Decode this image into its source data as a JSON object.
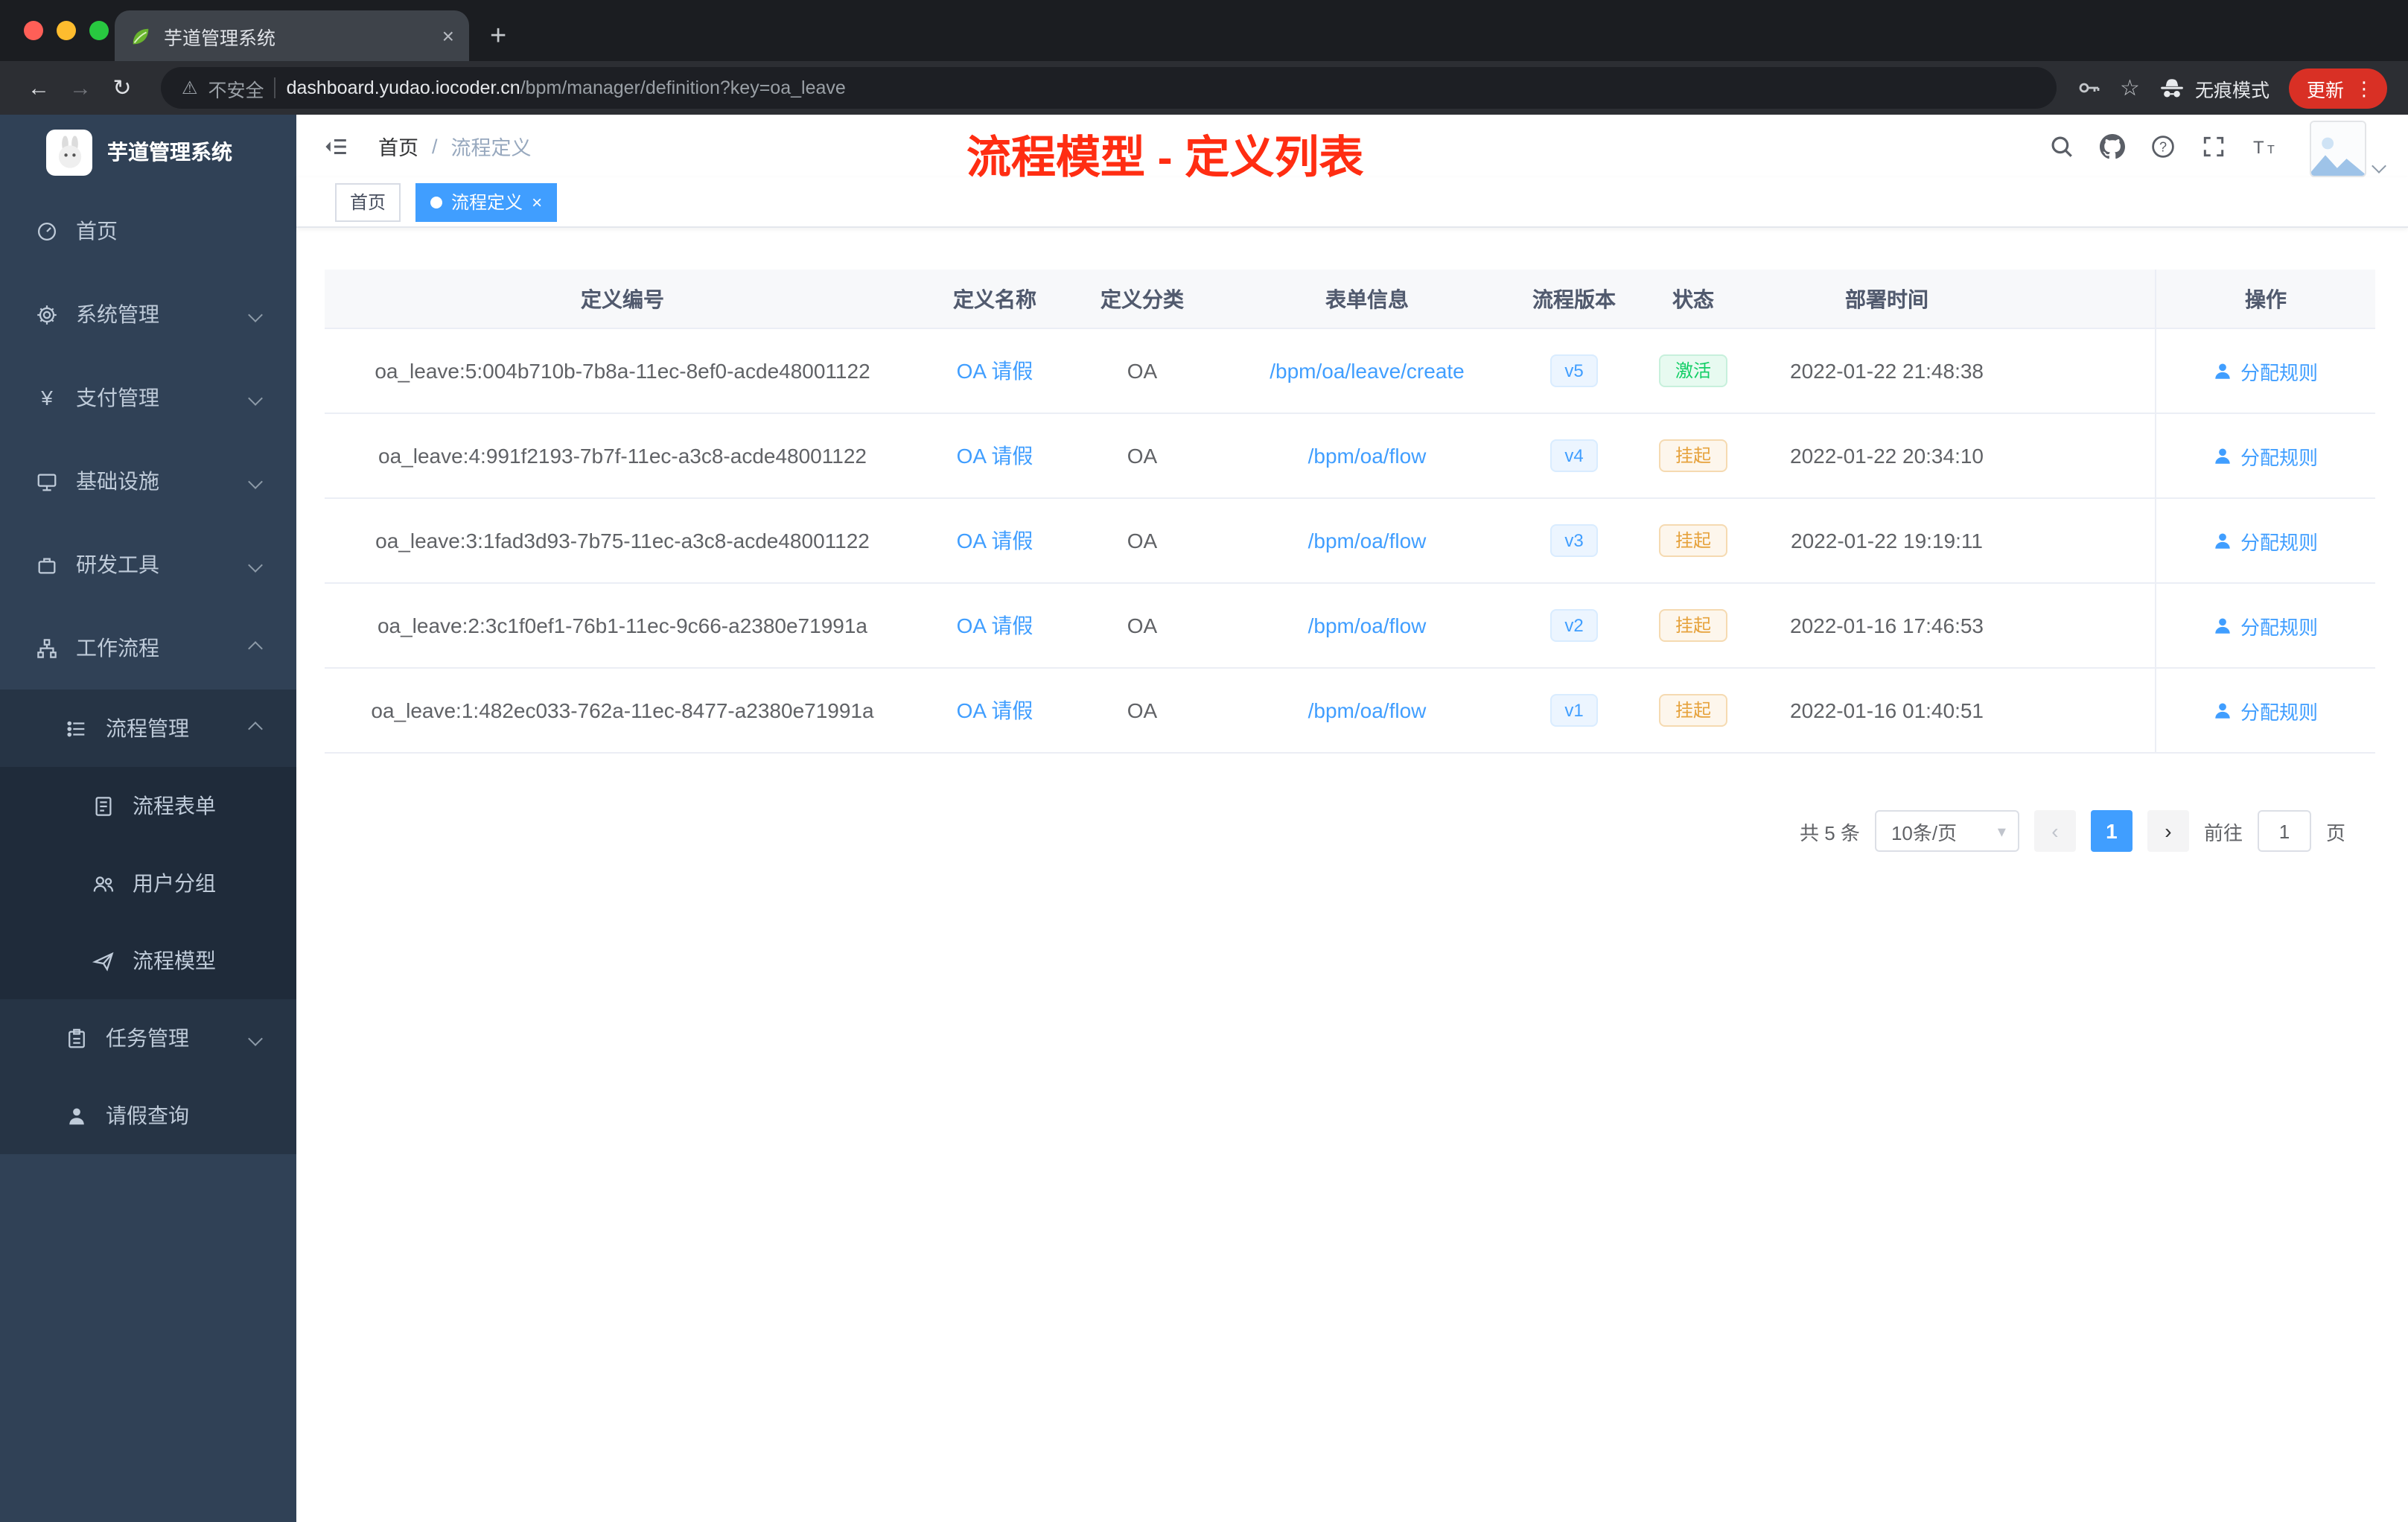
{
  "browser": {
    "tab_title": "芋道管理系统",
    "security_label": "不安全",
    "url_domain": "dashboard.yudao.iocoder.cn",
    "url_path": "/bpm/manager/definition?key=oa_leave",
    "incognito_label": "无痕模式",
    "update_label": "更新"
  },
  "sidebar": {
    "logo_title": "芋道管理系统",
    "items": [
      {
        "label": "首页"
      },
      {
        "label": "系统管理"
      },
      {
        "label": "支付管理"
      },
      {
        "label": "基础设施"
      },
      {
        "label": "研发工具"
      },
      {
        "label": "工作流程"
      },
      {
        "label": "流程管理"
      },
      {
        "label": "流程表单"
      },
      {
        "label": "用户分组"
      },
      {
        "label": "流程模型"
      },
      {
        "label": "任务管理"
      },
      {
        "label": "请假查询"
      }
    ]
  },
  "header": {
    "breadcrumb": [
      "首页",
      "流程定义"
    ],
    "annotation": "流程模型 - 定义列表"
  },
  "tags": [
    {
      "label": "首页",
      "active": false
    },
    {
      "label": "流程定义",
      "active": true
    }
  ],
  "table": {
    "columns": {
      "id": "定义编号",
      "name": "定义名称",
      "category": "定义分类",
      "form": "表单信息",
      "version": "流程版本",
      "status": "状态",
      "deploy_time": "部署时间",
      "action": "操作"
    },
    "rows": [
      {
        "id": "oa_leave:5:004b710b-7b8a-11ec-8ef0-acde48001122",
        "name": "OA 请假",
        "category": "OA",
        "form": "/bpm/oa/leave/create",
        "version": "v5",
        "status": "激活",
        "status_type": "success",
        "deploy_time": "2022-01-22 21:48:38",
        "action": "分配规则"
      },
      {
        "id": "oa_leave:4:991f2193-7b7f-11ec-a3c8-acde48001122",
        "name": "OA 请假",
        "category": "OA",
        "form": "/bpm/oa/flow",
        "version": "v4",
        "status": "挂起",
        "status_type": "warning",
        "deploy_time": "2022-01-22 20:34:10",
        "action": "分配规则"
      },
      {
        "id": "oa_leave:3:1fad3d93-7b75-11ec-a3c8-acde48001122",
        "name": "OA 请假",
        "category": "OA",
        "form": "/bpm/oa/flow",
        "version": "v3",
        "status": "挂起",
        "status_type": "warning",
        "deploy_time": "2022-01-22 19:19:11",
        "action": "分配规则"
      },
      {
        "id": "oa_leave:2:3c1f0ef1-76b1-11ec-9c66-a2380e71991a",
        "name": "OA 请假",
        "category": "OA",
        "form": "/bpm/oa/flow",
        "version": "v2",
        "status": "挂起",
        "status_type": "warning",
        "deploy_time": "2022-01-16 17:46:53",
        "action": "分配规则"
      },
      {
        "id": "oa_leave:1:482ec033-762a-11ec-8477-a2380e71991a",
        "name": "OA 请假",
        "category": "OA",
        "form": "/bpm/oa/flow",
        "version": "v1",
        "status": "挂起",
        "status_type": "warning",
        "deploy_time": "2022-01-16 01:40:51",
        "action": "分配规则"
      }
    ]
  },
  "pagination": {
    "total": "共 5 条",
    "page_size": "10条/页",
    "current": "1",
    "goto_label": "前往",
    "goto_value": "1",
    "goto_unit": "页"
  },
  "colors": {
    "accent": "#409eff",
    "success": "#13ce66",
    "warning": "#e6a23c",
    "annotation": "#ff2d12",
    "sidebar_bg": "#304156"
  }
}
